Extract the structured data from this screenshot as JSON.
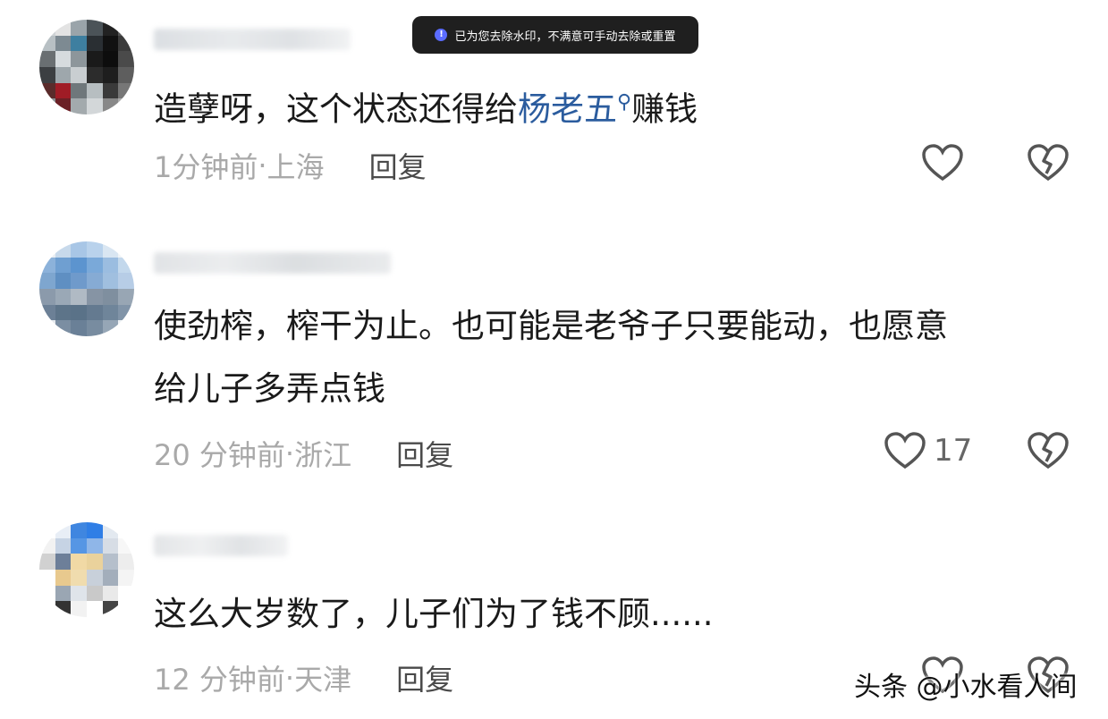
{
  "toast": {
    "icon": "info-icon",
    "text": "已为您去除水印，不满意可手动去除或重置"
  },
  "comments": [
    {
      "text_before": "造孽呀，这个状态还得给",
      "mention": "杨老五",
      "text_after": "赚钱",
      "time": "1分钟前",
      "location": "上海",
      "reply_label": "回复",
      "likes": ""
    },
    {
      "text_line1": "使劲榨，榨干为止。也可能是老爷子只要能动，也愿意",
      "text_line2": "给儿子多弄点钱",
      "time": "20 分钟前",
      "location": "浙江",
      "reply_label": "回复",
      "likes": "17"
    },
    {
      "text": "这么大岁数了，儿子们为了钱不顾......",
      "time": "12 分钟前",
      "location": "天津",
      "reply_label": "回复",
      "likes": ""
    }
  ],
  "meta_separator": " · ",
  "watermark": "头条 @小水看人间",
  "colors": {
    "mention": "#2b5c9e",
    "meta": "#a9a9a9",
    "toast_bg": "#1f1f1f"
  }
}
